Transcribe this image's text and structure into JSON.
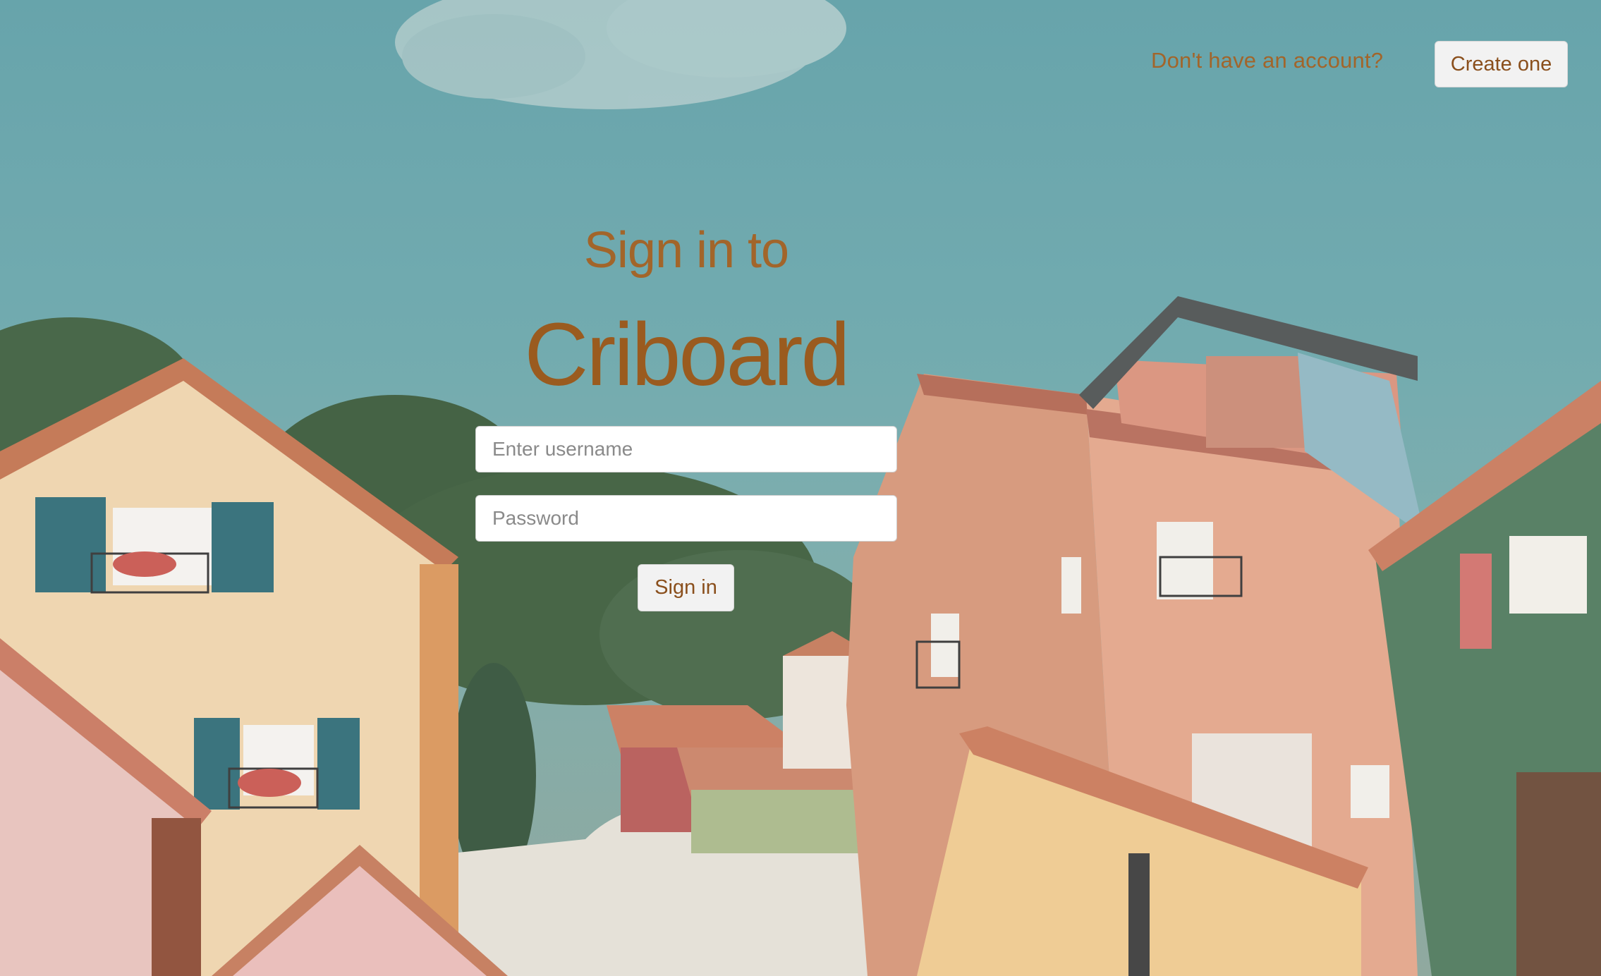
{
  "header": {
    "prompt_text": "Don't have an account?",
    "create_label": "Create one"
  },
  "login": {
    "heading": "Sign in to",
    "brand": "Criboard",
    "username_placeholder": "Enter username",
    "password_placeholder": "Password",
    "submit_label": "Sign in"
  },
  "colors": {
    "text_accent": "#a2652a",
    "sky": "#5e9fa6",
    "button_bg": "#f2f2f2"
  }
}
